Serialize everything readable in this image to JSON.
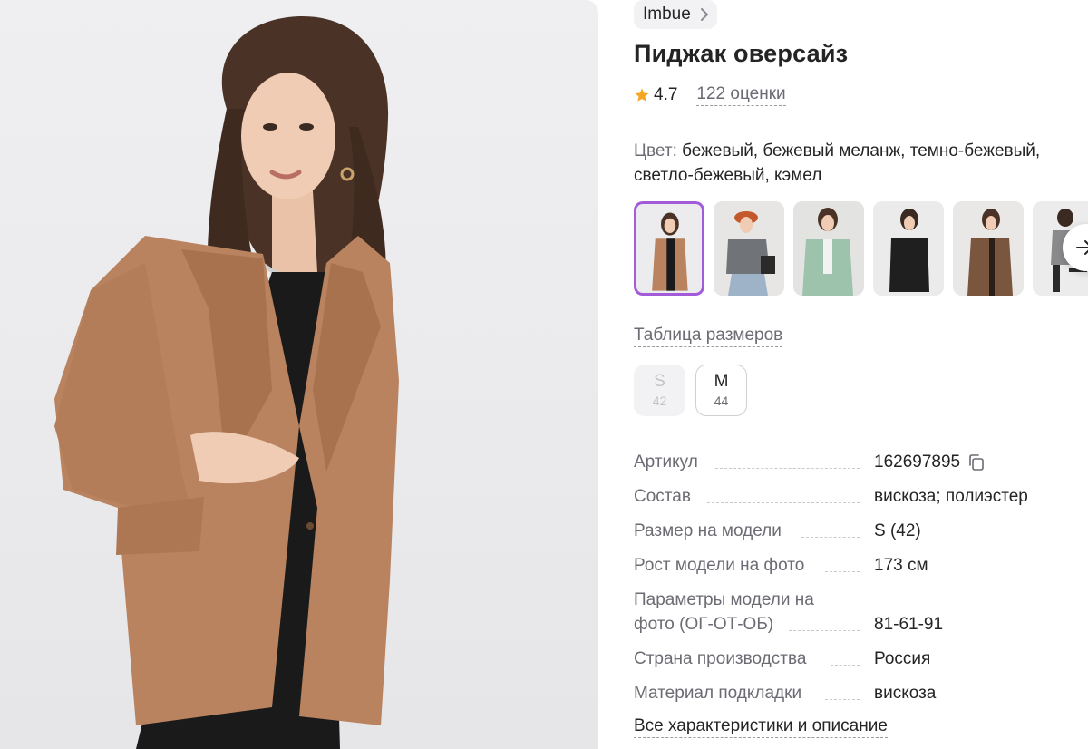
{
  "brand": {
    "label": "Imbue"
  },
  "product": {
    "title": "Пиджак оверсайз",
    "rating": "4.7",
    "reviews": "122 оценки"
  },
  "color": {
    "label": "Цвет:",
    "value": "бежевый, бежевый меланж, темно-бежевый, светло-бежевый, кэмел"
  },
  "thumbnails": [
    {
      "name": "camel-blazer",
      "active": true
    },
    {
      "name": "grey-blazer-cap"
    },
    {
      "name": "mint-blazer"
    },
    {
      "name": "black-blazer"
    },
    {
      "name": "brown-check-blazer"
    },
    {
      "name": "grey-blazer-chair"
    }
  ],
  "size_table_label": "Таблица размеров",
  "sizes": [
    {
      "size": "S",
      "ru": "42",
      "available": false
    },
    {
      "size": "M",
      "ru": "44",
      "available": true
    }
  ],
  "specs": [
    {
      "key": "Артикул",
      "value": "162697895"
    },
    {
      "key": "Состав",
      "value": "вискоза; полиэстер"
    },
    {
      "key": "Размер на модели",
      "value": "S (42)"
    },
    {
      "key": "Рост модели на фото",
      "value": "173 см"
    },
    {
      "key1": "Параметры модели на",
      "key2": "фото (ОГ-ОТ-ОБ)",
      "value": "81-61-91"
    },
    {
      "key": "Страна производства",
      "value": "Россия"
    },
    {
      "key": "Материал подкладки",
      "value": "вискоза"
    }
  ],
  "all_specs_label": "Все характеристики и описание",
  "colors": {
    "accent": "#a25bd9",
    "star": "#f5a623",
    "muted": "#6b6b73",
    "text": "#242424"
  }
}
